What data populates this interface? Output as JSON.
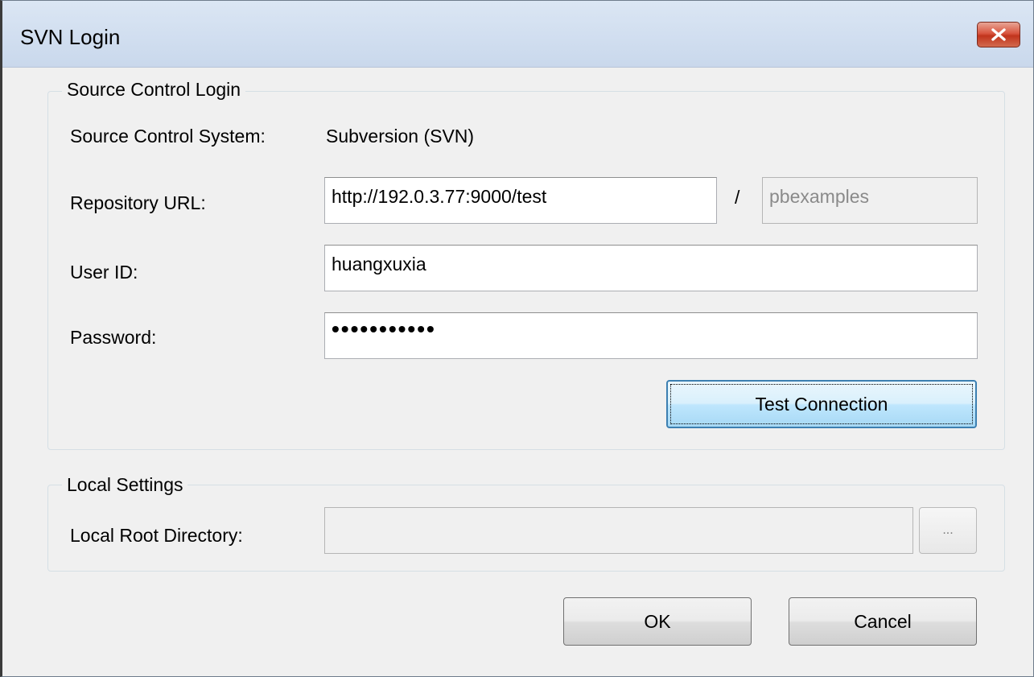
{
  "window": {
    "title": "SVN Login"
  },
  "source_control": {
    "group_title": "Source Control Login",
    "system_label": "Source Control System:",
    "system_value": "Subversion (SVN)",
    "repository_url_label": "Repository URL:",
    "repository_url_value": "http://192.0.3.77:9000/test",
    "separator": "/",
    "repository_name_value": "pbexamples",
    "user_id_label": "User ID:",
    "user_id_value": "huangxuxia",
    "password_label": "Password:",
    "password_value": "•••••••••••",
    "test_connection_label": "Test Connection"
  },
  "local_settings": {
    "group_title": "Local Settings",
    "root_directory_label": "Local Root Directory:",
    "root_directory_value": "",
    "browse_label": "..."
  },
  "footer": {
    "ok_label": "OK",
    "cancel_label": "Cancel"
  },
  "icons": {
    "close": "close-icon"
  }
}
